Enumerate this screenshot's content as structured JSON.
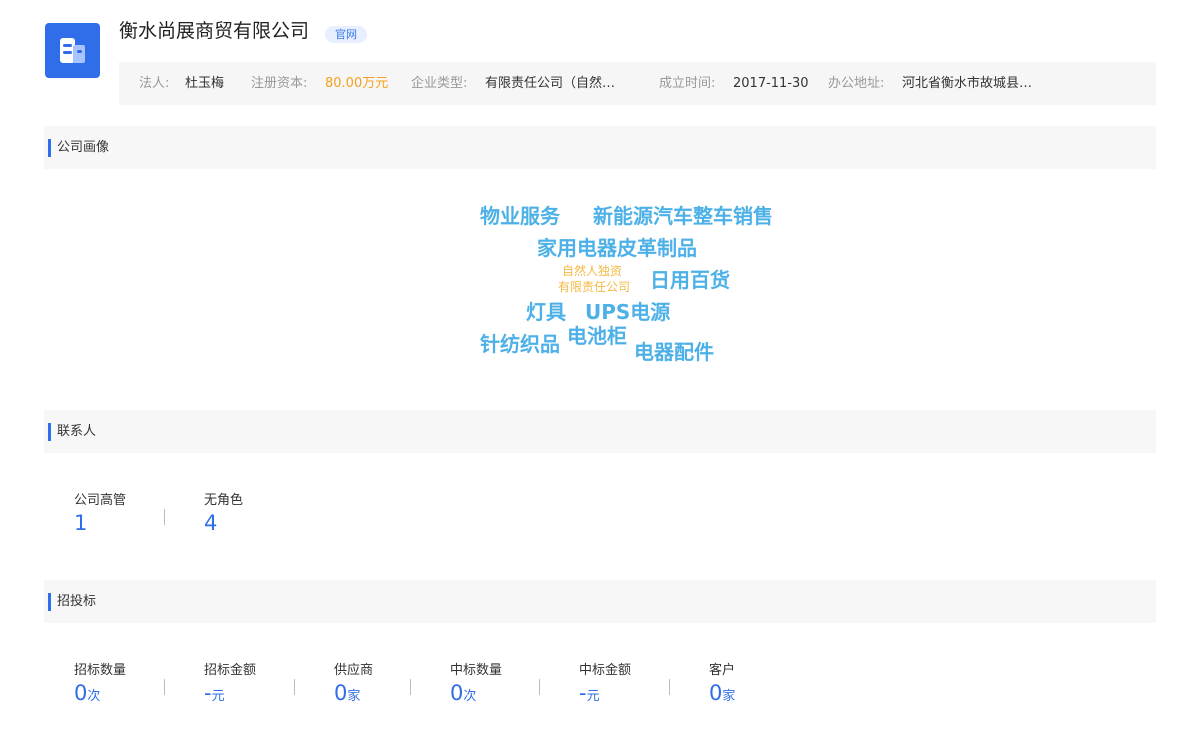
{
  "header": {
    "company_name": "衡水尚展商贸有限公司",
    "official_badge": "官网",
    "info": {
      "legal_person_label": "法人:",
      "legal_person": "杜玉梅",
      "capital_label": "注册资本:",
      "capital": "80.00万元",
      "type_label": "企业类型:",
      "type": "有限责任公司（自然…",
      "founded_label": "成立时间:",
      "founded": "2017-11-30",
      "address_label": "办公地址:",
      "address": "河北省衡水市故城县…"
    }
  },
  "portrait": {
    "title": "公司画像",
    "words": [
      "物业服务",
      "新能源汽车整车销售",
      "家用电器皮革制品",
      "自然人独资",
      "有限责任公司",
      "日用百货",
      "灯具",
      "UPS电源",
      "针纺织品",
      "电池柜",
      "电器配件"
    ]
  },
  "contacts": {
    "title": "联系人",
    "stats": [
      {
        "label": "公司高管",
        "value": "1"
      },
      {
        "label": "无角色",
        "value": "4"
      }
    ]
  },
  "bidding": {
    "title": "招投标",
    "stats": [
      {
        "label": "招标数量",
        "value": "0",
        "unit": "次"
      },
      {
        "label": "招标金额",
        "value": "-",
        "unit": "元"
      },
      {
        "label": "供应商",
        "value": "0",
        "unit": "家"
      },
      {
        "label": "中标数量",
        "value": "0",
        "unit": "次"
      },
      {
        "label": "中标金额",
        "value": "-",
        "unit": "元"
      },
      {
        "label": "客户",
        "value": "0",
        "unit": "家"
      }
    ]
  },
  "colors": {
    "accent": "#2f6ee8",
    "word_blue": "#4db1e8",
    "word_orange": "#f4b942",
    "capital_orange": "#f4a21e"
  }
}
